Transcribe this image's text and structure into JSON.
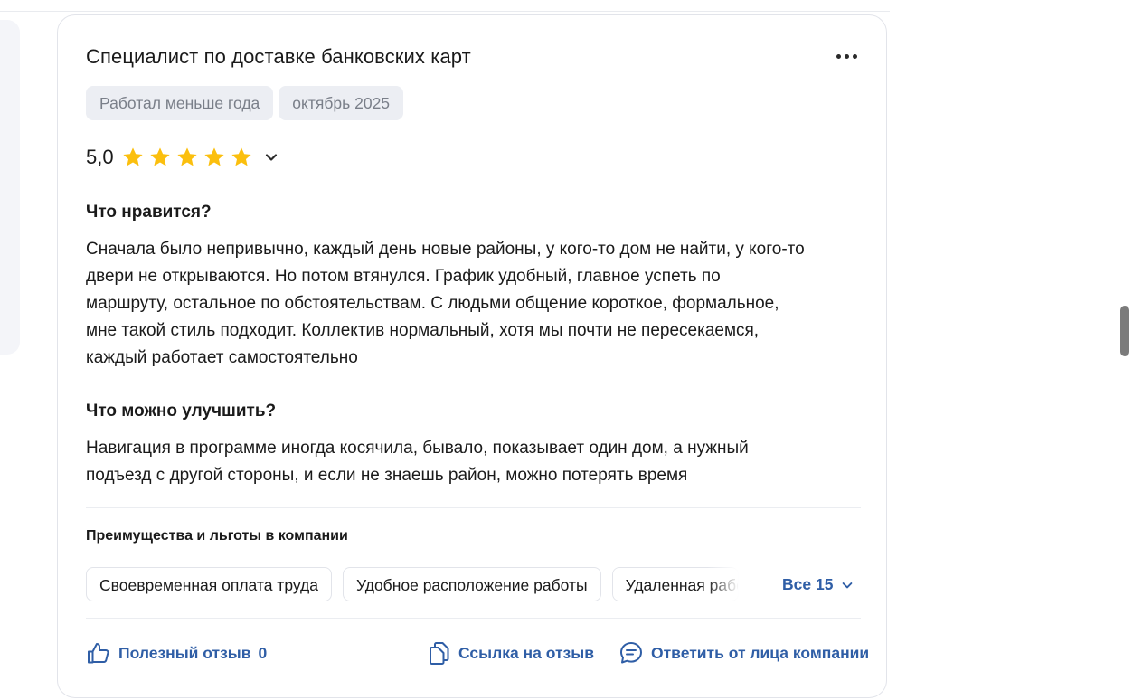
{
  "review": {
    "title": "Специалист по доставке банковских карт",
    "tags": [
      "Работал меньше года",
      "октябрь 2025"
    ],
    "rating_value": "5,0",
    "rating_stars": 5,
    "pros_title": "Что нравится?",
    "pros_text": "Сначала было непривычно, каждый день новые районы, у кого-то дом не найти, у кого-то\nдвери не открываются. Но потом втянулся. График удобный, главное успеть по\nмаршруту, остальное по обстоятельствам. С людьми общение короткое, формальное,\nмне такой стиль подходит. Коллектив нормальный, хотя мы почти не пересекаемся,\nкаждый работает самостоятельно",
    "cons_title": "Что можно улучшить?",
    "cons_text": "Навигация в программе иногда косячила, бывало, показывает один дом, а нужный\nподъезд с другой стороны, и если не знаешь район, можно потерять время",
    "benefits_title": "Преимущества и льготы в компании",
    "benefits": [
      "Своевременная оплата труда",
      "Удобное расположение работы",
      "Удаленная работа"
    ],
    "all_benefits_label": "Все 15"
  },
  "actions": {
    "helpful_label": "Полезный отзыв",
    "helpful_count": "0",
    "link_label": "Ссылка на отзыв",
    "reply_label": "Ответить от лица компании"
  },
  "colors": {
    "accent": "#2f5ea6",
    "star": "#fbbf0e",
    "chip_bg": "#eceef3",
    "border": "#e2e4ea"
  },
  "icons": [
    "more-icon",
    "star-icon",
    "chevron-down-icon",
    "thumbs-up-icon",
    "copy-link-icon",
    "chat-icon"
  ]
}
